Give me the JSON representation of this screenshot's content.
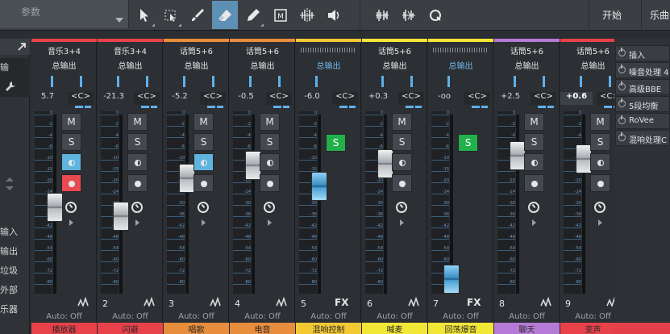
{
  "toolbar": {
    "preset_placeholder": "参数",
    "tools": [
      "select-arrow-icon",
      "range-select-icon",
      "paint-brush-icon",
      "eraser-icon",
      "pencil-icon",
      "mute-tool-icon",
      "split-tool-icon",
      "listen-tool-icon",
      "bend-tool-icon",
      "bend-marker-icon",
      "quantize-icon"
    ],
    "active_tool": "eraser-icon",
    "start_label": "开始",
    "song_label": "乐曲"
  },
  "left_panel": {
    "top_label": "输",
    "items": [
      "输入",
      "输出",
      "垃圾",
      "外部",
      "乐器"
    ]
  },
  "channels": [
    {
      "name": "音乐3+4",
      "route": "总输出",
      "volume": "5.7",
      "pan": "<C>",
      "number": "",
      "automation": "Auto: Off",
      "label": "播放器",
      "color": "#e8414a",
      "fader_level": 0.48,
      "monitor_on": true,
      "record_on": true,
      "solo_on": false,
      "fx": false
    },
    {
      "name": "音乐3+4",
      "route": "总输出",
      "volume": "-21.3",
      "pan": "<C>",
      "number": "2",
      "automation": "Auto: Off",
      "label": "闪避",
      "color": "#e8414a",
      "fader_level": 0.42,
      "monitor_on": false,
      "record_on": false,
      "solo_on": false,
      "fx": false
    },
    {
      "name": "话筒5+6",
      "route": "总输出",
      "volume": "-5.2",
      "pan": "<C>",
      "number": "3",
      "automation": "Auto: Off",
      "label": "唱歌",
      "color": "#e88d3c",
      "fader_level": 0.67,
      "monitor_on": true,
      "record_on": false,
      "solo_on": false,
      "fx": false
    },
    {
      "name": "话筒5+6",
      "route": "总输出",
      "volume": "-0.5",
      "pan": "<C>",
      "number": "4",
      "automation": "Auto: Off",
      "label": "电音",
      "color": "#e88d3c",
      "fader_level": 0.76,
      "monitor_on": false,
      "record_on": false,
      "solo_on": false,
      "fx": false
    },
    {
      "name": "",
      "route": "总输出",
      "volume": "-6.0",
      "pan": "<C>",
      "number": "5",
      "automation": "Auto: Off",
      "label": "混响控制",
      "color": "#f2c933",
      "fader_level": 0.62,
      "monitor_on": false,
      "record_on": false,
      "solo_on": true,
      "fx": true,
      "blue_fader": true
    },
    {
      "name": "话筒5+6",
      "route": "总输出",
      "volume": "+0.3",
      "pan": "<C>",
      "number": "6",
      "automation": "Auto: Off",
      "label": "喊麦",
      "color": "#f2e637",
      "fader_level": 0.77,
      "monitor_on": false,
      "record_on": false,
      "solo_on": false,
      "fx": false
    },
    {
      "name": "",
      "route": "总输出",
      "volume": "-oo",
      "pan": "<C>",
      "number": "7",
      "automation": "Auto: Off",
      "label": "回荡爆音",
      "color": "#f2e637",
      "fader_level": 0.0,
      "monitor_on": false,
      "record_on": false,
      "solo_on": true,
      "fx": true,
      "blue_fader": true
    },
    {
      "name": "话筒5+6",
      "route": "总输出",
      "volume": "+2.5",
      "pan": "<C>",
      "number": "8",
      "automation": "Auto: Off",
      "label": "聊天",
      "color": "#b57ad6",
      "fader_level": 0.82,
      "monitor_on": false,
      "record_on": false,
      "solo_on": false,
      "fx": false
    },
    {
      "name": "话筒5+6",
      "route": "总输出",
      "volume": "+0.6",
      "pan": "<C>",
      "number": "9",
      "automation": "Auto: Off",
      "label": "变声",
      "color": "#e8414a",
      "fader_level": 0.8,
      "monitor_on": false,
      "record_on": false,
      "solo_on": false,
      "fx": false,
      "highlight": true
    }
  ],
  "meter_scale": [
    "0",
    "-2",
    "-4",
    "-6",
    "-10",
    "-15",
    "-20",
    "-24",
    "-30",
    "-36",
    "-42",
    "-48",
    "-54",
    "-60",
    "-72",
    "-80"
  ],
  "button_labels": {
    "mute": "M",
    "solo": "S"
  },
  "inserts": {
    "title": "插入",
    "items": [
      "噪音处理 4",
      "高级BBE",
      "5段均衡",
      "RoVee",
      "混响处理C"
    ]
  }
}
